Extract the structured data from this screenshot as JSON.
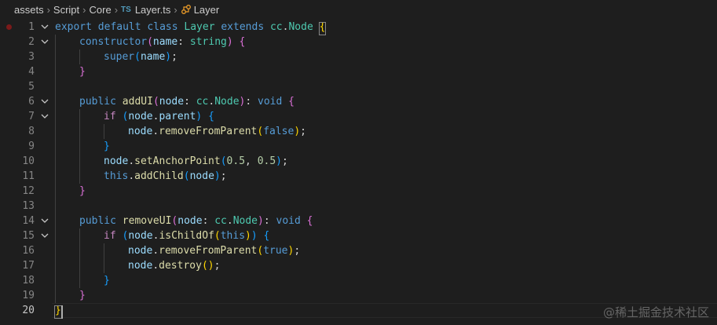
{
  "breadcrumb": {
    "items": [
      "assets",
      "Script",
      "Core"
    ],
    "file_icon": "TS",
    "file": "Layer.ts",
    "symbol": "Layer"
  },
  "editor": {
    "active_line": 20,
    "breakpoint_line": 1,
    "lines": [
      {
        "n": "1",
        "fold": true,
        "indent": 0,
        "tokens": [
          [
            "k",
            "export"
          ],
          [
            "p",
            " "
          ],
          [
            "k",
            "default"
          ],
          [
            "p",
            " "
          ],
          [
            "k",
            "class"
          ],
          [
            "p",
            " "
          ],
          [
            "t",
            "Layer"
          ],
          [
            "p",
            " "
          ],
          [
            "k",
            "extends"
          ],
          [
            "p",
            " "
          ],
          [
            "t",
            "cc"
          ],
          [
            "p",
            "."
          ],
          [
            "t",
            "Node"
          ],
          [
            "p",
            " "
          ],
          [
            "b1",
            "{"
          ]
        ]
      },
      {
        "n": "2",
        "fold": true,
        "indent": 1,
        "tokens": [
          [
            "k",
            "constructor"
          ],
          [
            "b2",
            "("
          ],
          [
            "v",
            "name"
          ],
          [
            "p",
            ": "
          ],
          [
            "t",
            "string"
          ],
          [
            "b2",
            ")"
          ],
          [
            "p",
            " "
          ],
          [
            "b2",
            "{"
          ]
        ]
      },
      {
        "n": "3",
        "fold": false,
        "indent": 2,
        "tokens": [
          [
            "k",
            "super"
          ],
          [
            "b3",
            "("
          ],
          [
            "v",
            "name"
          ],
          [
            "b3",
            ")"
          ],
          [
            "p",
            ";"
          ]
        ]
      },
      {
        "n": "4",
        "fold": false,
        "indent": 1,
        "tokens": [
          [
            "b2",
            "}"
          ]
        ]
      },
      {
        "n": "5",
        "fold": false,
        "indent": 0,
        "tokens": []
      },
      {
        "n": "6",
        "fold": true,
        "indent": 1,
        "tokens": [
          [
            "k",
            "public"
          ],
          [
            "p",
            " "
          ],
          [
            "f",
            "addUI"
          ],
          [
            "b2",
            "("
          ],
          [
            "v",
            "node"
          ],
          [
            "p",
            ": "
          ],
          [
            "t",
            "cc"
          ],
          [
            "p",
            "."
          ],
          [
            "t",
            "Node"
          ],
          [
            "b2",
            ")"
          ],
          [
            "p",
            ": "
          ],
          [
            "k",
            "void"
          ],
          [
            "p",
            " "
          ],
          [
            "b2",
            "{"
          ]
        ]
      },
      {
        "n": "7",
        "fold": true,
        "indent": 2,
        "tokens": [
          [
            "c",
            "if"
          ],
          [
            "p",
            " "
          ],
          [
            "b3",
            "("
          ],
          [
            "v",
            "node"
          ],
          [
            "p",
            "."
          ],
          [
            "v",
            "parent"
          ],
          [
            "b3",
            ")"
          ],
          [
            "p",
            " "
          ],
          [
            "b3",
            "{"
          ]
        ]
      },
      {
        "n": "8",
        "fold": false,
        "indent": 3,
        "tokens": [
          [
            "v",
            "node"
          ],
          [
            "p",
            "."
          ],
          [
            "f",
            "removeFromParent"
          ],
          [
            "b1",
            "("
          ],
          [
            "k",
            "false"
          ],
          [
            "b1",
            ")"
          ],
          [
            "p",
            ";"
          ]
        ]
      },
      {
        "n": "9",
        "fold": false,
        "indent": 2,
        "tokens": [
          [
            "b3",
            "}"
          ]
        ]
      },
      {
        "n": "10",
        "fold": false,
        "indent": 2,
        "tokens": [
          [
            "v",
            "node"
          ],
          [
            "p",
            "."
          ],
          [
            "f",
            "setAnchorPoint"
          ],
          [
            "b3",
            "("
          ],
          [
            "n",
            "0.5"
          ],
          [
            "p",
            ", "
          ],
          [
            "n",
            "0.5"
          ],
          [
            "b3",
            ")"
          ],
          [
            "p",
            ";"
          ]
        ]
      },
      {
        "n": "11",
        "fold": false,
        "indent": 2,
        "tokens": [
          [
            "k",
            "this"
          ],
          [
            "p",
            "."
          ],
          [
            "f",
            "addChild"
          ],
          [
            "b3",
            "("
          ],
          [
            "v",
            "node"
          ],
          [
            "b3",
            ")"
          ],
          [
            "p",
            ";"
          ]
        ]
      },
      {
        "n": "12",
        "fold": false,
        "indent": 1,
        "tokens": [
          [
            "b2",
            "}"
          ]
        ]
      },
      {
        "n": "13",
        "fold": false,
        "indent": 0,
        "tokens": []
      },
      {
        "n": "14",
        "fold": true,
        "indent": 1,
        "tokens": [
          [
            "k",
            "public"
          ],
          [
            "p",
            " "
          ],
          [
            "f",
            "removeUI"
          ],
          [
            "b2",
            "("
          ],
          [
            "v",
            "node"
          ],
          [
            "p",
            ": "
          ],
          [
            "t",
            "cc"
          ],
          [
            "p",
            "."
          ],
          [
            "t",
            "Node"
          ],
          [
            "b2",
            ")"
          ],
          [
            "p",
            ": "
          ],
          [
            "k",
            "void"
          ],
          [
            "p",
            " "
          ],
          [
            "b2",
            "{"
          ]
        ]
      },
      {
        "n": "15",
        "fold": true,
        "indent": 2,
        "tokens": [
          [
            "c",
            "if"
          ],
          [
            "p",
            " "
          ],
          [
            "b3",
            "("
          ],
          [
            "v",
            "node"
          ],
          [
            "p",
            "."
          ],
          [
            "f",
            "isChildOf"
          ],
          [
            "b1",
            "("
          ],
          [
            "k",
            "this"
          ],
          [
            "b1",
            ")"
          ],
          [
            "b3",
            ")"
          ],
          [
            "p",
            " "
          ],
          [
            "b3",
            "{"
          ]
        ]
      },
      {
        "n": "16",
        "fold": false,
        "indent": 3,
        "tokens": [
          [
            "v",
            "node"
          ],
          [
            "p",
            "."
          ],
          [
            "f",
            "removeFromParent"
          ],
          [
            "b1",
            "("
          ],
          [
            "k",
            "true"
          ],
          [
            "b1",
            ")"
          ],
          [
            "p",
            ";"
          ]
        ]
      },
      {
        "n": "17",
        "fold": false,
        "indent": 3,
        "tokens": [
          [
            "v",
            "node"
          ],
          [
            "p",
            "."
          ],
          [
            "f",
            "destroy"
          ],
          [
            "b1",
            "()"
          ],
          [
            "p",
            ";"
          ]
        ]
      },
      {
        "n": "18",
        "fold": false,
        "indent": 2,
        "tokens": [
          [
            "b3",
            "}"
          ]
        ]
      },
      {
        "n": "19",
        "fold": false,
        "indent": 1,
        "tokens": [
          [
            "b2",
            "}"
          ]
        ]
      },
      {
        "n": "20",
        "fold": false,
        "indent": 0,
        "tokens": [
          [
            "b1",
            "}"
          ]
        ]
      }
    ]
  },
  "colors": {
    "background": "#1e1e1e",
    "keyword": "#569cd6",
    "control": "#c586c0",
    "type": "#4ec9b0",
    "function": "#dcdcaa",
    "variable": "#9cdcfe",
    "number": "#b5cea8"
  },
  "watermark": "@稀土掘金技术社区"
}
